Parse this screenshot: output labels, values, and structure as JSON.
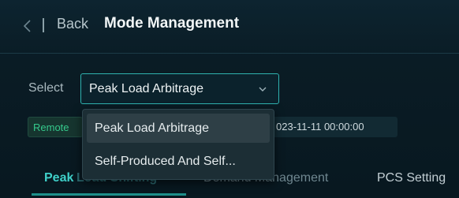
{
  "header": {
    "back_label": "Back",
    "title": "Mode Management"
  },
  "select": {
    "label": "Select",
    "value": "Peak Load Arbitrage",
    "options": [
      "Peak Load Arbitrage",
      "Self-Produced And Self..."
    ]
  },
  "status": {
    "remote": "Remote",
    "date": "023-11-11 00:00:00"
  },
  "tabs": [
    {
      "label": "Peak",
      "label_rest": "Load Shifting"
    },
    {
      "label": "Demand Management"
    },
    {
      "label": "PCS Setting"
    }
  ],
  "colors": {
    "accent": "#2fb3b0",
    "active_tab": "#3fd0c9",
    "remote_green": "#35c98c",
    "background": "#0b1c26"
  }
}
